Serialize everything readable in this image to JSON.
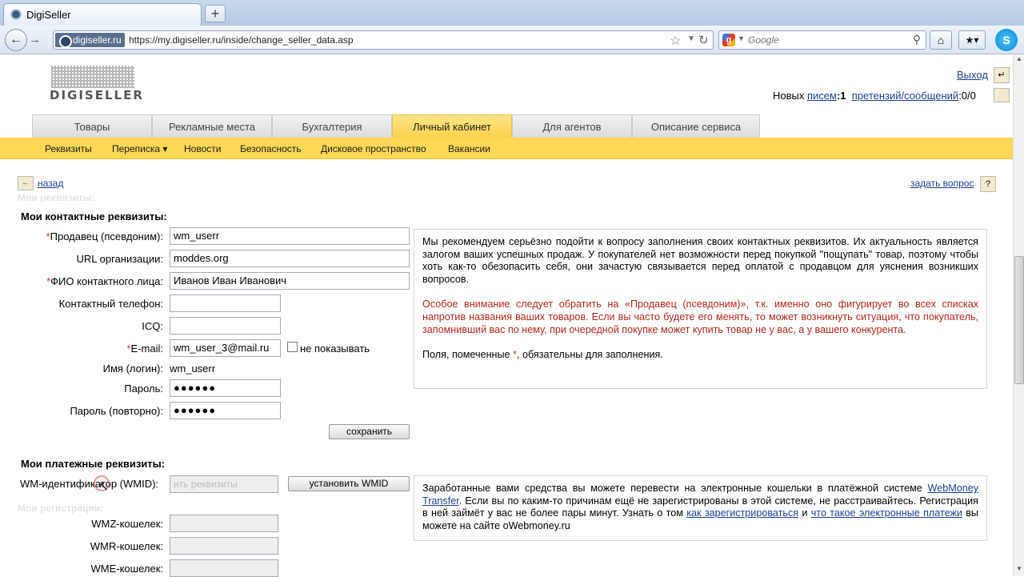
{
  "browser": {
    "tab_title": "DigiSeller",
    "new_tab": "+",
    "site_badge": "digiseller.ru",
    "url": "https://my.digiseller.ru/inside/change_seller_data.asp",
    "search_placeholder": "Google",
    "skype": "S"
  },
  "header": {
    "logo_text": "DIGISELLER",
    "logout": "Выход",
    "new_label": "Новых",
    "letters_link": "писем",
    "letters_count": ":1",
    "claims_link": "претензий/сообщений",
    "claims_count": ":0/0"
  },
  "menu": {
    "tabs": [
      {
        "label": "Товары"
      },
      {
        "label": "Рекламные места"
      },
      {
        "label": "Бухгалтерия"
      },
      {
        "label": "Личный кабинет"
      },
      {
        "label": "Для агентов"
      },
      {
        "label": "Описание сервиса"
      }
    ],
    "active_tab": "Личный кабинет",
    "subitems": [
      {
        "label": "Реквизиты"
      },
      {
        "label": "Переписка"
      },
      {
        "label": "Новости"
      },
      {
        "label": "Безопасность"
      },
      {
        "label": "Дисковое пространство"
      },
      {
        "label": "Вакансии"
      }
    ]
  },
  "nav": {
    "back": "назад",
    "ask": "задать вопрос"
  },
  "contacts": {
    "heading": "Мои контактные реквизиты:",
    "required_mark": "*",
    "fields": [
      {
        "label": "Продавец (псевдоним):",
        "required": true,
        "value": "wm_userr"
      },
      {
        "label": "URL организации:",
        "required": false,
        "value": "moddes.org"
      },
      {
        "label": "ФИО контактного лица:",
        "required": true,
        "value": "Иванов Иван Иванович"
      },
      {
        "label": "Контактный телефон:",
        "required": false,
        "value": ""
      },
      {
        "label": "ICQ:",
        "required": false,
        "value": ""
      },
      {
        "label": "E-mail:",
        "required": true,
        "value": "wm_user_3@mail.ru"
      },
      {
        "label": "Имя (логин):",
        "required": false,
        "value": "wm_userr"
      },
      {
        "label": "Пароль:",
        "required": false,
        "value": "●●●●●●"
      },
      {
        "label": "Пароль (повторно):",
        "required": false,
        "value": "●●●●●●"
      }
    ],
    "hide_email": "не показывать",
    "save": "сохранить"
  },
  "info1": {
    "p1": "Мы рекомендуем серьёзно подойти к вопросу заполнения своих контактных реквизитов. Их актуальность является залогом ваших успешных продаж. У покупателей нет возможности перед покупкой \"пощупать\" товар, поэтому чтобы хоть как-то обезопасить себя, они зачастую связывается перед оплатой с продавцом для уяснения возникших вопросов.",
    "p2": "Особое внимание следует обратить на «Продавец (псевдоним)», т.к. именно оно фигурирует во всех списках напротив названия ваших товаров. Если вы часто будете его менять, то может возникнуть ситуация, что покупатель, запомнивший вас по нему, при очередной покупке может купить товар не у вас, а у вашего конкурента.",
    "p3a": "Поля, помеченные ",
    "p3mark": "*",
    "p3b": ", обязательны для заполнения."
  },
  "payments": {
    "heading": "Мои платежные реквизиты:",
    "wmid_label": "WM-идентификатор (WMID):",
    "wmid_placeholder": "ить реквизиты",
    "set_wmid": "установить WMID",
    "wmz": "WMZ-кошелек:",
    "wmr": "WMR-кошелек:",
    "wme": "WME-кошелек:"
  },
  "info2": {
    "t1": "Заработанные вами средства вы можете перевести на электронные кошельки в платёжной системе ",
    "link1": "WebMoney Transfer",
    "t2": ". Если вы по каким-то причинам ещё не зарегистрированы в этой системе, не расстраивайтесь. Регистрация в ней займёт у вас не более пары минут. Узнать о том ",
    "link2": "как зарегистрироваться",
    "t3": " и ",
    "link3": "что такое электронные платежи",
    "t4": " вы можете на сайте oWebmoney.ru"
  },
  "ghost": {
    "my_requisites": "Мои реквизиты:",
    "my_registrations": "Мои регистрации:"
  }
}
